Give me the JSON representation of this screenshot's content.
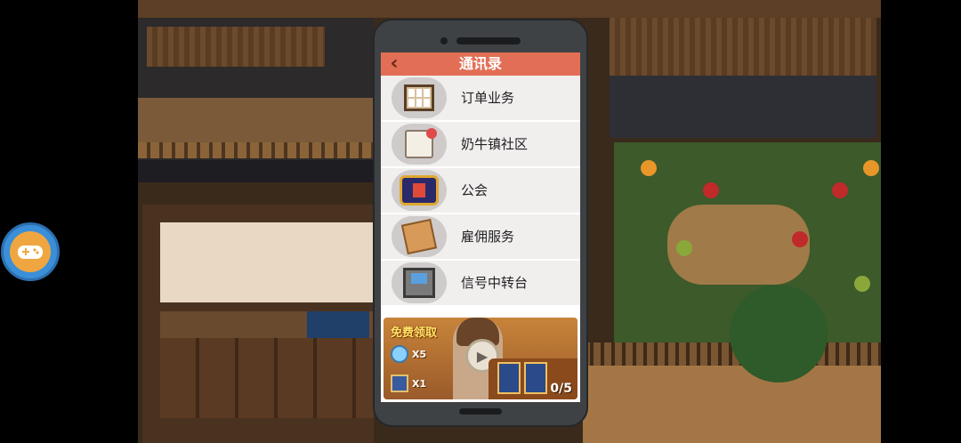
{
  "phone": {
    "title": "通讯录",
    "items": [
      {
        "label": "订单业务",
        "icon": "order-board-icon"
      },
      {
        "label": "奶牛镇社区",
        "icon": "community-letter-icon"
      },
      {
        "label": "公会",
        "icon": "guild-emblem-icon"
      },
      {
        "label": "雇佣服务",
        "icon": "hire-contract-icon"
      },
      {
        "label": "信号中转台",
        "icon": "signal-relay-icon"
      }
    ]
  },
  "banner": {
    "free_claim": "免费领取",
    "rewards": [
      {
        "icon": "diamond-icon",
        "qty": "X5"
      },
      {
        "icon": "character-card-icon",
        "qty": "X1"
      }
    ],
    "progress": "0/5"
  },
  "colors": {
    "titlebar": "#e26f55",
    "gamepad_outer": "#3a8fd8",
    "gamepad_inner": "#f0a640"
  }
}
